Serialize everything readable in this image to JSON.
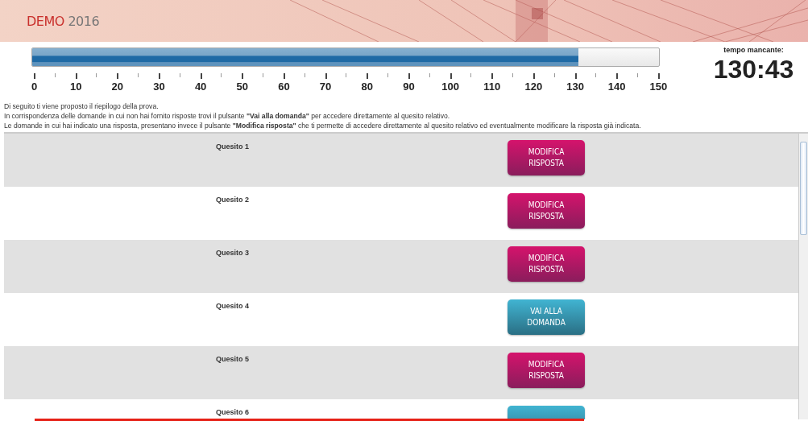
{
  "header": {
    "brand": "DEMO",
    "year": "2016"
  },
  "progress": {
    "level": 0.871,
    "scale": [
      "0",
      "10",
      "20",
      "30",
      "40",
      "50",
      "60",
      "70",
      "80",
      "90",
      "100",
      "110",
      "120",
      "130",
      "140",
      "150"
    ]
  },
  "timer": {
    "label": "tempo mancante:",
    "value": "130:43"
  },
  "intro": [
    "Di seguito ti viene proposto il riepilogo della prova.",
    "In corrispondenza delle domande in cui non hai fornito risposte trovi il pulsante **\"Vai alla domanda\"** per accedere direttamente al quesito relativo.",
    "Le domande in cui hai indicato una risposta, presentano invece il pulsante **\"Modifica risposta\"** che ti permette di accedere direttamente al quesito relativo ed eventualmente modificare la risposta già indicata."
  ],
  "questions": [
    {
      "label": "Quesito 1",
      "kind": "modify",
      "button": "MODIFICA RISPOSTA"
    },
    {
      "label": "Quesito 2",
      "kind": "modify",
      "button": "MODIFICA RISPOSTA"
    },
    {
      "label": "Quesito 3",
      "kind": "modify",
      "button": "MODIFICA RISPOSTA"
    },
    {
      "label": "Quesito 4",
      "kind": "goto",
      "button": "VAI ALLA DOMANDA"
    },
    {
      "label": "Quesito 5",
      "kind": "modify",
      "button": "MODIFICA RISPOSTA"
    },
    {
      "label": "Quesito 6",
      "kind": "goto"
    }
  ],
  "player_progress": {
    "level": 0.71
  }
}
